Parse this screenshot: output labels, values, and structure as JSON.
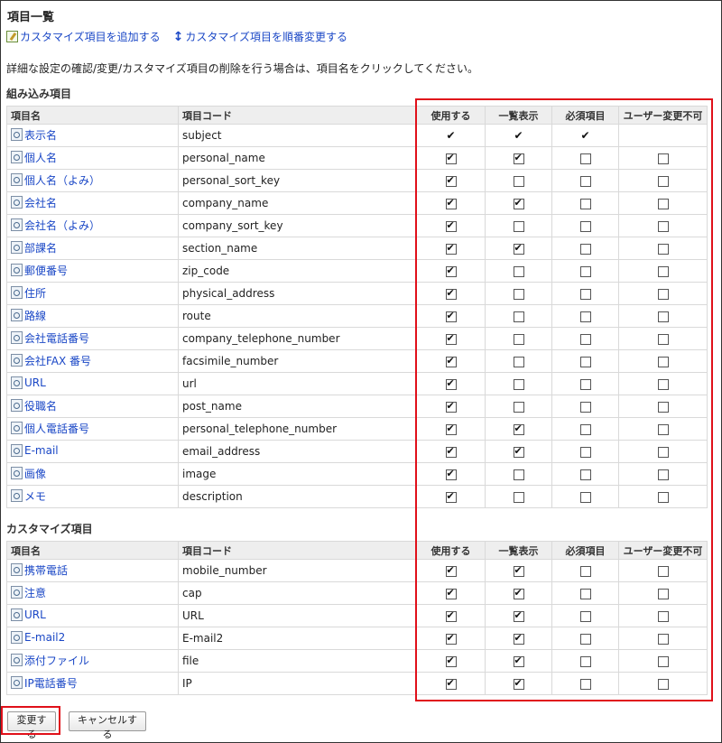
{
  "page_title": "項目一覧",
  "links": [
    {
      "label": "カスタマイズ項目を追加する",
      "icon": "add-item-icon"
    },
    {
      "label": "カスタマイズ項目を順番変更する",
      "icon": "sort-icon"
    }
  ],
  "description": "詳細な設定の確認/変更/カスタマイズ項目の削除を行う場合は、項目名をクリックしてください。",
  "builtin": {
    "section_title": "組み込み項目",
    "headers": [
      "項目名",
      "項目コード",
      "使用する",
      "一覧表示",
      "必須項目",
      "ユーザー変更不可"
    ],
    "rows": [
      {
        "name": "表示名",
        "code": "subject",
        "use": "tick",
        "list": "tick",
        "required": "tick",
        "locked": "none"
      },
      {
        "name": "個人名",
        "code": "personal_name",
        "use": true,
        "list": true,
        "required": false,
        "locked": false
      },
      {
        "name": "個人名（よみ）",
        "code": "personal_sort_key",
        "use": true,
        "list": false,
        "required": false,
        "locked": false
      },
      {
        "name": "会社名",
        "code": "company_name",
        "use": true,
        "list": true,
        "required": false,
        "locked": false
      },
      {
        "name": "会社名（よみ）",
        "code": "company_sort_key",
        "use": true,
        "list": false,
        "required": false,
        "locked": false
      },
      {
        "name": "部課名",
        "code": "section_name",
        "use": true,
        "list": true,
        "required": false,
        "locked": false
      },
      {
        "name": "郵便番号",
        "code": "zip_code",
        "use": true,
        "list": false,
        "required": false,
        "locked": false
      },
      {
        "name": "住所",
        "code": "physical_address",
        "use": true,
        "list": false,
        "required": false,
        "locked": false
      },
      {
        "name": "路線",
        "code": "route",
        "use": true,
        "list": false,
        "required": false,
        "locked": false
      },
      {
        "name": "会社電話番号",
        "code": "company_telephone_number",
        "use": true,
        "list": false,
        "required": false,
        "locked": false
      },
      {
        "name": "会社FAX 番号",
        "code": "facsimile_number",
        "use": true,
        "list": false,
        "required": false,
        "locked": false
      },
      {
        "name": "URL",
        "code": "url",
        "use": true,
        "list": false,
        "required": false,
        "locked": false
      },
      {
        "name": "役職名",
        "code": "post_name",
        "use": true,
        "list": false,
        "required": false,
        "locked": false
      },
      {
        "name": "個人電話番号",
        "code": "personal_telephone_number",
        "use": true,
        "list": true,
        "required": false,
        "locked": false
      },
      {
        "name": "E-mail",
        "code": "email_address",
        "use": true,
        "list": true,
        "required": false,
        "locked": false
      },
      {
        "name": "画像",
        "code": "image",
        "use": true,
        "list": false,
        "required": false,
        "locked": false
      },
      {
        "name": "メモ",
        "code": "description",
        "use": true,
        "list": false,
        "required": false,
        "locked": false
      }
    ]
  },
  "custom": {
    "section_title": "カスタマイズ項目",
    "headers": [
      "項目名",
      "項目コード",
      "使用する",
      "一覧表示",
      "必須項目",
      "ユーザー変更不可"
    ],
    "rows": [
      {
        "name": "携帯電話",
        "code": "mobile_number",
        "use": true,
        "list": true,
        "required": false,
        "locked": false
      },
      {
        "name": "注意",
        "code": "cap",
        "use": true,
        "list": true,
        "required": false,
        "locked": false
      },
      {
        "name": "URL",
        "code": "URL",
        "use": true,
        "list": true,
        "required": false,
        "locked": false
      },
      {
        "name": "E-mail2",
        "code": "E-mail2",
        "use": true,
        "list": true,
        "required": false,
        "locked": false
      },
      {
        "name": "添付ファイル",
        "code": "file",
        "use": true,
        "list": true,
        "required": false,
        "locked": false
      },
      {
        "name": "IP電話番号",
        "code": "IP",
        "use": true,
        "list": true,
        "required": false,
        "locked": false
      }
    ]
  },
  "buttons": {
    "submit": "変更する",
    "cancel": "キャンセルする"
  },
  "colors": {
    "link": "#1a47c6",
    "highlight": "#e0101a",
    "header_bg": "#eeeeee"
  }
}
